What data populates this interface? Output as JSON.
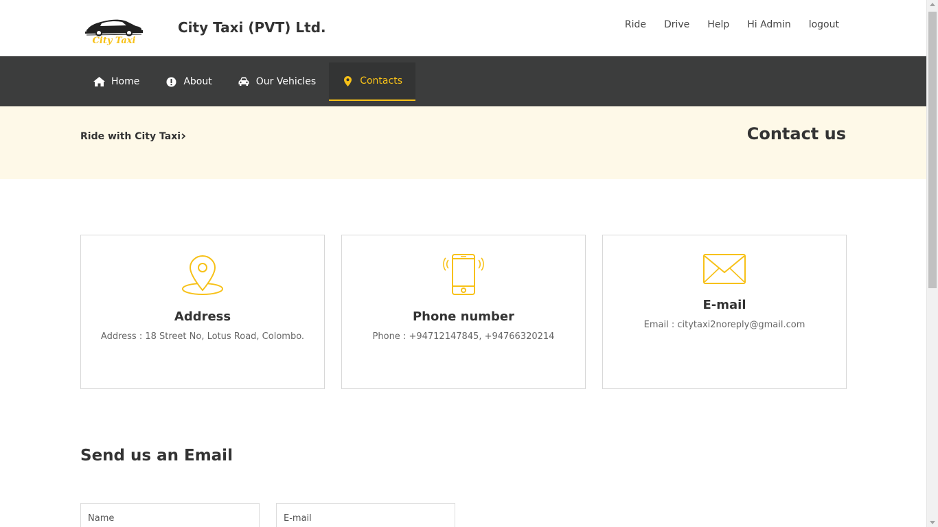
{
  "header": {
    "logo_text": "City Taxi",
    "brand_title": "City Taxi (PVT) Ltd.",
    "links": [
      {
        "label": "Ride"
      },
      {
        "label": "Drive"
      },
      {
        "label": "Help"
      },
      {
        "label": "Hi Admin"
      },
      {
        "label": "logout"
      }
    ]
  },
  "nav": {
    "items": [
      {
        "label": "Home",
        "icon": "home-icon",
        "active": false
      },
      {
        "label": "About",
        "icon": "info-icon",
        "active": false
      },
      {
        "label": "Our Vehicles",
        "icon": "car-icon",
        "active": false
      },
      {
        "label": "Contacts",
        "icon": "map-pin-icon",
        "active": true
      }
    ]
  },
  "banner": {
    "breadcrumb": "Ride with City Taxi",
    "title": "Contact us"
  },
  "cards": [
    {
      "title": "Address",
      "text": "Address : 18 Street No, Lotus Road, Colombo.",
      "icon": "location-pin-icon"
    },
    {
      "title": "Phone number",
      "text": "Phone : +94712147845, +94766320214",
      "icon": "phone-icon"
    },
    {
      "title": "E-mail",
      "text": "Email : citytaxi2noreply@gmail.com",
      "icon": "envelope-icon"
    }
  ],
  "form": {
    "title": "Send us an Email",
    "name_placeholder": "Name",
    "email_placeholder": "E-mail"
  },
  "colors": {
    "accent": "#f7c118",
    "nav_bg": "#3c3d3d",
    "banner_bg": "#fef9e8"
  }
}
